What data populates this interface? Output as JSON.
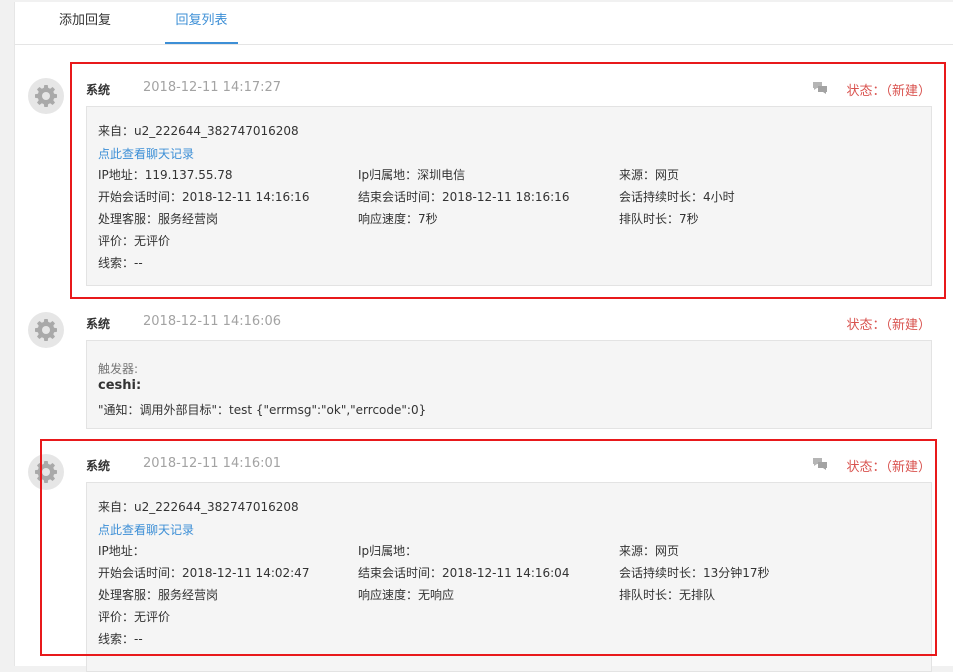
{
  "tabs": [
    {
      "label": "添加回复",
      "active": false
    },
    {
      "label": "回复列表",
      "active": true
    }
  ],
  "entries": [
    {
      "author": "系统",
      "time": "2018-12-11 14:17:27",
      "status": "状态：（新建）",
      "from": "来自：u2_222644_382747016208",
      "chat_link": "点此查看聊天记录",
      "ip": "IP地址：119.137.55.78",
      "ip_location": "Ip归属地：深圳电信",
      "source": "来源：网页",
      "start_time": "开始会话时间：2018-12-11 14:16:16",
      "end_time": "结束会话时间：2018-12-11 18:16:16",
      "duration": "会话持续时长：4小时",
      "agent": "处理客服：服务经营岗",
      "response": "响应速度：7秒",
      "queue": "排队时长：7秒",
      "rating": "评价：无评价",
      "clue": "线索：--"
    },
    {
      "author": "系统",
      "time": "2018-12-11 14:16:06",
      "status": "状态：（新建）",
      "trigger_label": "触发器:",
      "trigger_name": "ceshi:",
      "notify": "\"通知：调用外部目标\"：test {\"errmsg\":\"ok\",\"errcode\":0}"
    },
    {
      "author": "系统",
      "time": "2018-12-11 14:16:01",
      "status": "状态：（新建）",
      "from": "来自：u2_222644_382747016208",
      "chat_link": "点此查看聊天记录",
      "ip": "IP地址：",
      "ip_location": "Ip归属地：",
      "source": "来源：网页",
      "start_time": "开始会话时间：2018-12-11 14:02:47",
      "end_time": "结束会话时间：2018-12-11 14:16:04",
      "duration": "会话持续时长：13分钟17秒",
      "agent": "处理客服：服务经营岗",
      "response": "响应速度：无响应",
      "queue": "排队时长：无排队",
      "rating": "评价：无评价",
      "clue": "线索：--"
    }
  ],
  "colors": {
    "accent": "#3d8fd6",
    "status": "#d9534f",
    "highlight": "#e8191b"
  },
  "icons": {
    "avatar": "gear-icon",
    "comment": "chat-bubble-icon"
  }
}
